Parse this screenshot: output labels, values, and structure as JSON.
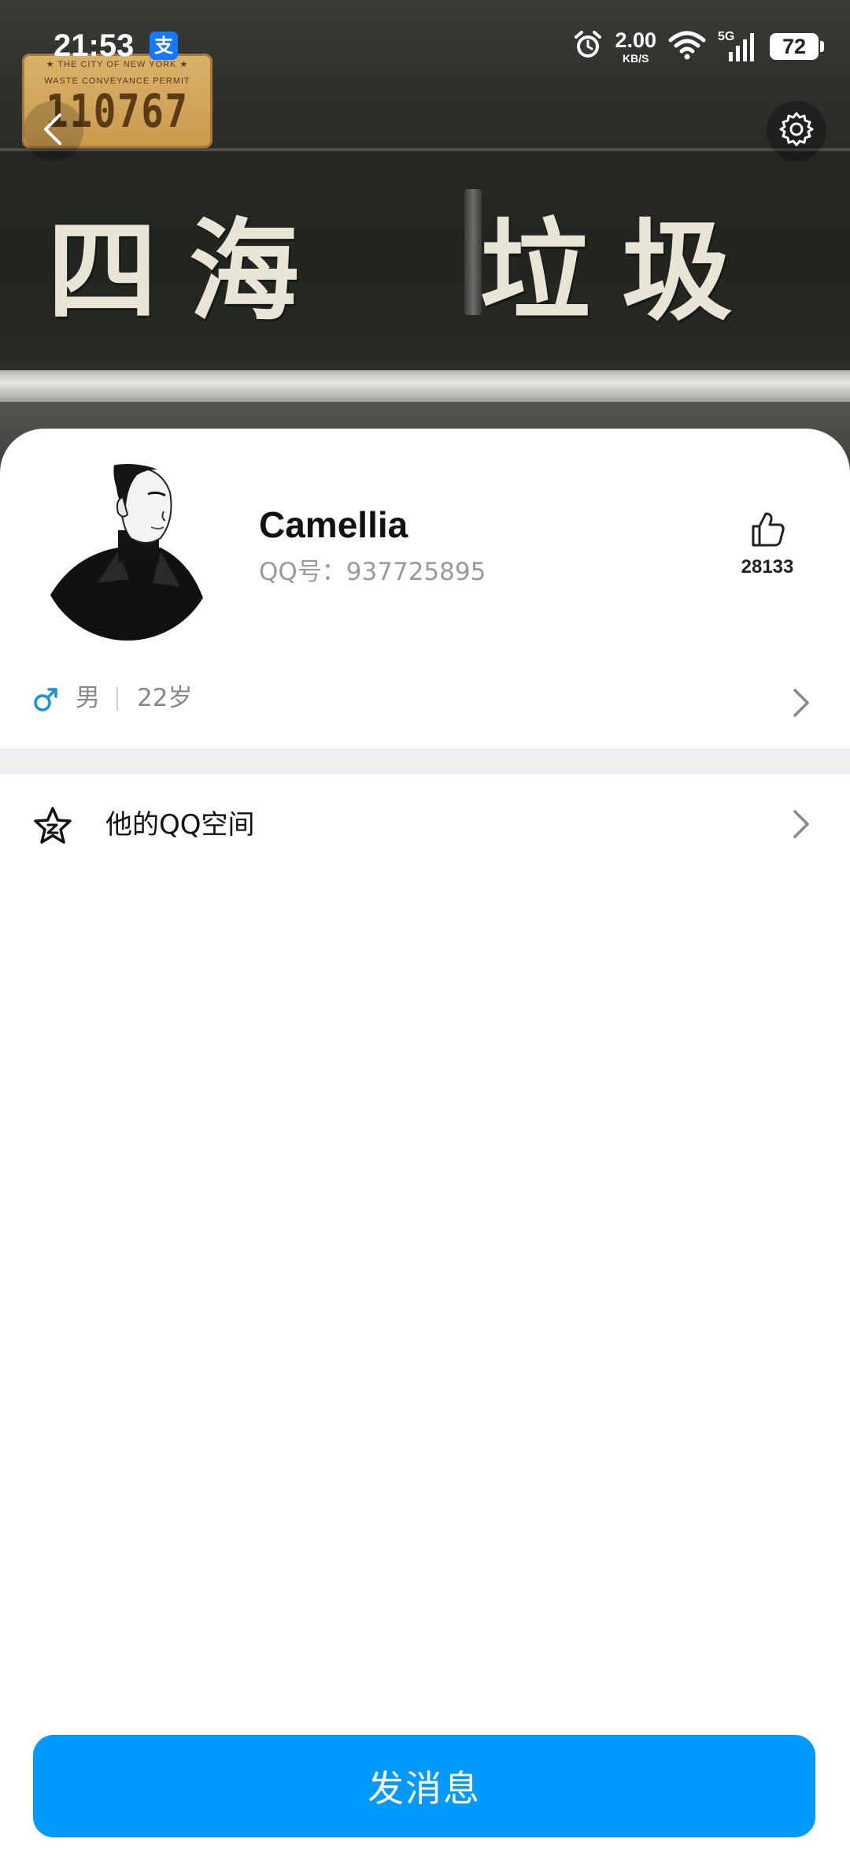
{
  "status_bar": {
    "time": "21:53",
    "alipay_badge": "支",
    "net_speed_value": "2.00",
    "net_speed_unit": "KB/S",
    "network_type": "5G",
    "battery_level": "72",
    "icons": [
      "alarm-icon",
      "wifi-icon",
      "cellular-signal-icon",
      "battery-icon"
    ]
  },
  "nav": {
    "back_icon": "chevron-left-icon",
    "settings_icon": "gear-icon"
  },
  "cover": {
    "plate_line1": "★ THE CITY OF NEW YORK ★",
    "plate_line2": "WASTE CONVEYANCE PERMIT",
    "plate_number": "110767",
    "sign_left": "四海",
    "sign_right": "垃圾"
  },
  "profile": {
    "nickname": "Camellia",
    "qq_label": "QQ号：937725895",
    "like_count": "28133",
    "gender_symbol": "♂",
    "gender": "男",
    "age": "22岁"
  },
  "qzone": {
    "label": "他的QQ空间",
    "icon": "qzone-star-icon"
  },
  "actions": {
    "send_message": "发消息"
  },
  "colors": {
    "primary": "#0099ff",
    "gender_male": "#1a8fe0",
    "section_gap": "#efeff1",
    "secondary_text": "#888888"
  }
}
